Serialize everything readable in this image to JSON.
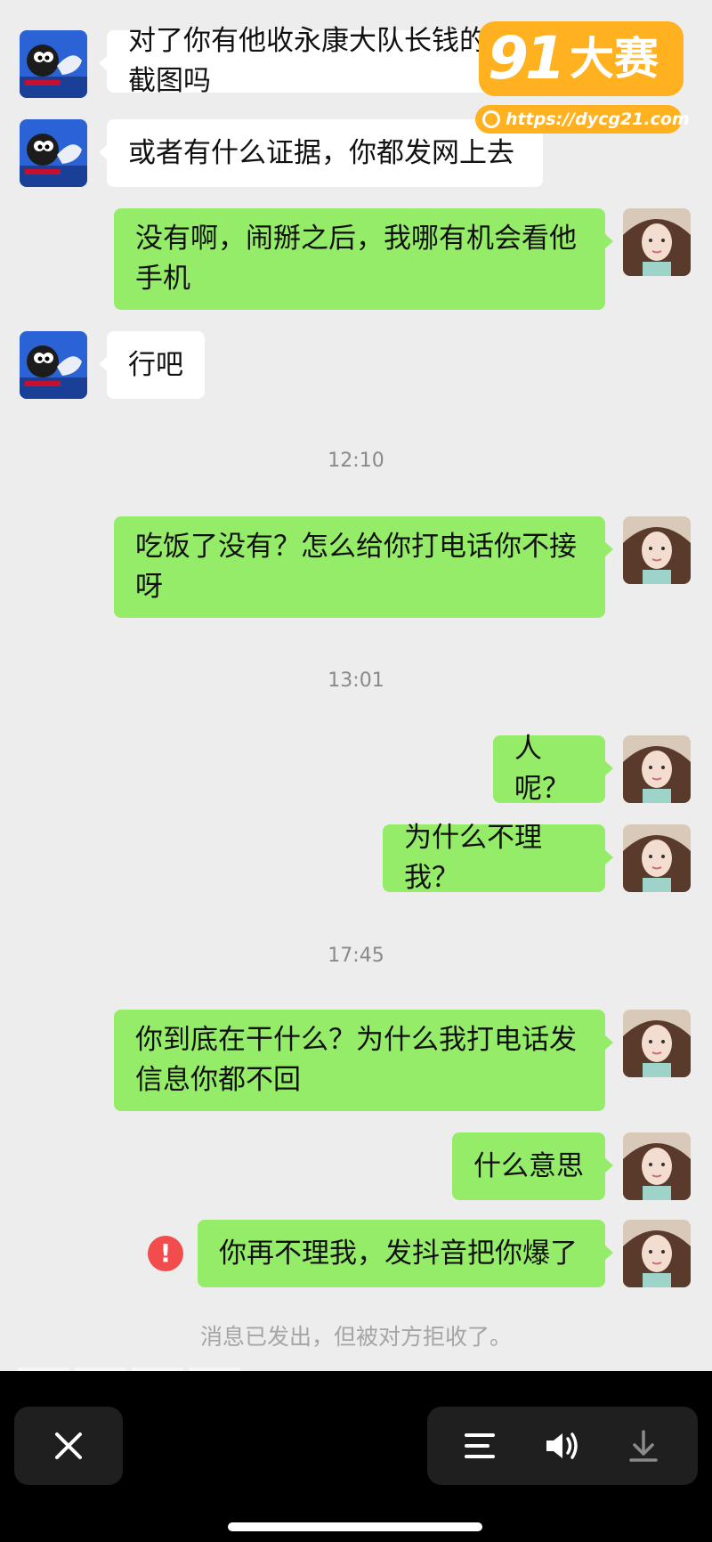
{
  "messages": [
    {
      "side": "left",
      "text": "对了你有他收永康大队长钱的截图吗"
    },
    {
      "side": "left",
      "text": "或者有什么证据，你都发网上去"
    },
    {
      "side": "right",
      "text": "没有啊，闹掰之后，我哪有机会看他\n手机"
    },
    {
      "side": "left",
      "text": "行吧"
    },
    {
      "side": "right",
      "text": "吃饭了没有？怎么给你打电话你不接\n呀"
    },
    {
      "side": "right",
      "text": "人呢？"
    },
    {
      "side": "right",
      "text": "为什么不理我？"
    },
    {
      "side": "right",
      "text": "你到底在干什么？为什么我打电话发\n信息你都不回"
    },
    {
      "side": "right",
      "text": "什么意思"
    },
    {
      "side": "right",
      "text": "你再不理我，发抖音把你爆了",
      "failed": true
    }
  ],
  "timestamps": [
    "12:10",
    "13:01",
    "17:45"
  ],
  "system_notice": "消息已发出，但被对方拒收了。",
  "error_badge": "!",
  "watermark": {
    "logo_number": "91",
    "logo_text": "大赛",
    "url": "https://dycg21.com",
    "color": "#ffb11f"
  },
  "toolbar": {
    "close_icon": "close-icon",
    "menu_icon": "menu-icon",
    "volume_icon": "volume-icon",
    "download_icon": "download-icon"
  },
  "colors": {
    "chat_background": "#ededed",
    "sent_bubble": "#95ec69",
    "received_bubble": "#ffffff",
    "error": "#f24c4c"
  }
}
